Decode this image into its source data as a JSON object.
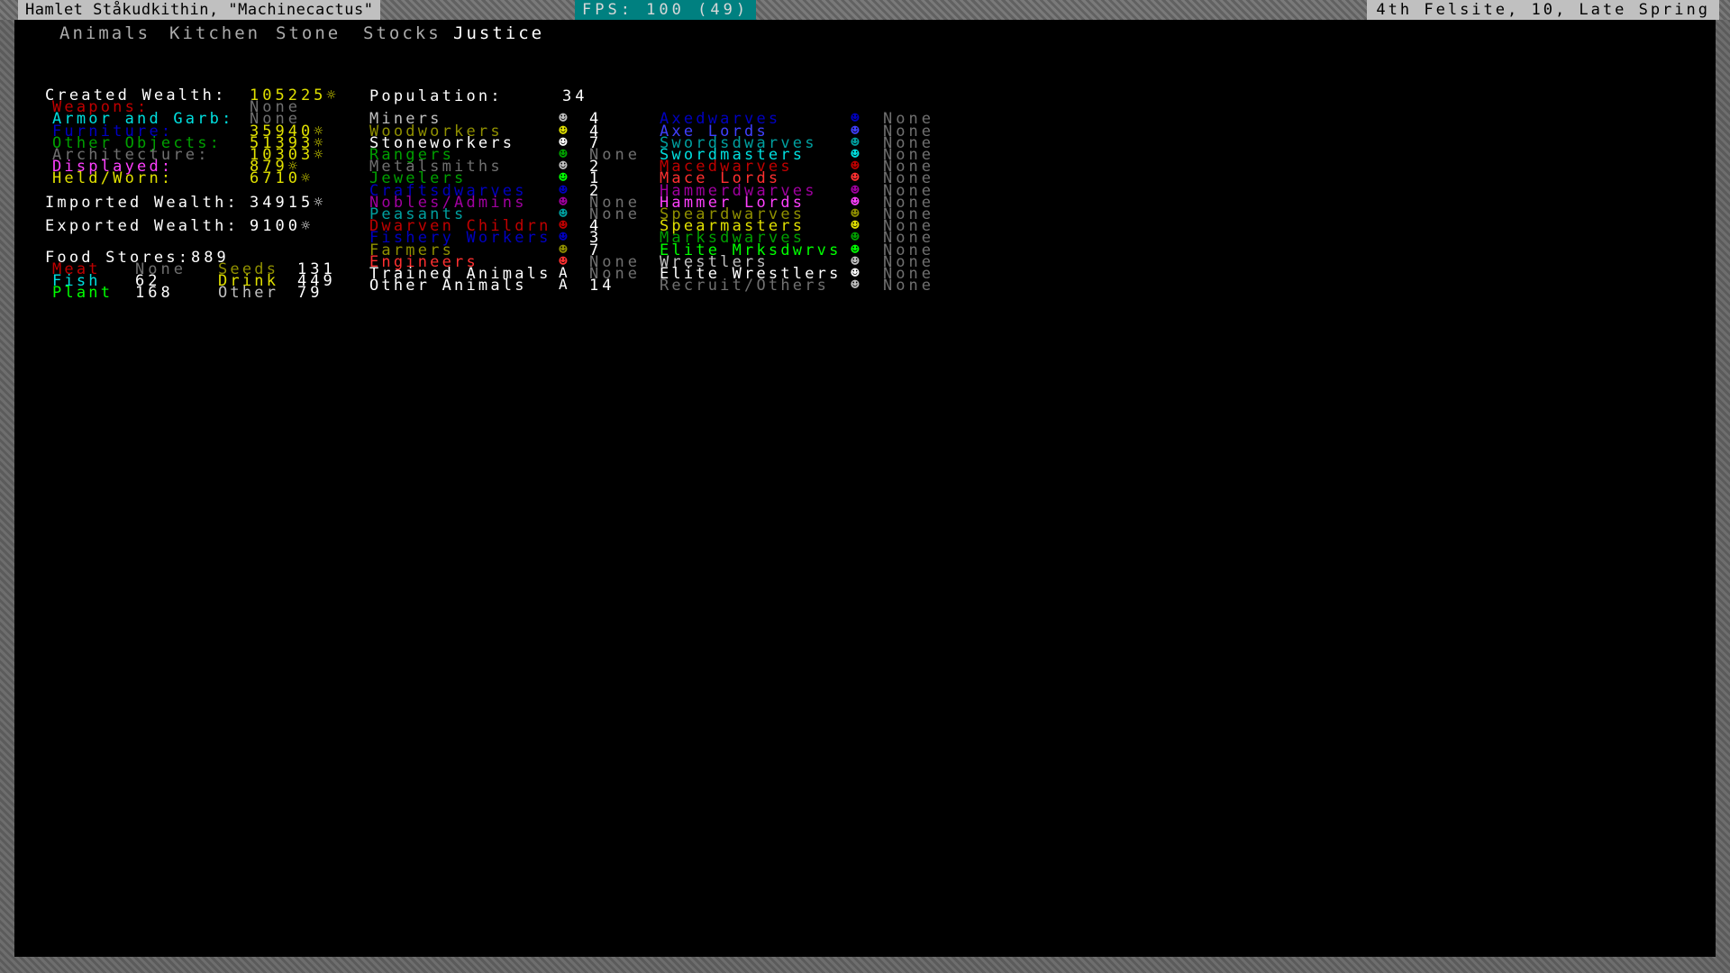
{
  "window": {
    "fort_title": "Hamlet Ståkudkithin, \"Machinecactus\"",
    "fps": "FPS: 100 (49)",
    "date": "4th Felsite, 10, Late Spring"
  },
  "menubar": {
    "items": [
      {
        "label": "Animals",
        "selected": false
      },
      {
        "label": "Kitchen",
        "selected": false
      },
      {
        "label": "Stone",
        "selected": false
      },
      {
        "label": "Stocks",
        "selected": false
      },
      {
        "label": "Justice",
        "selected": true
      }
    ]
  },
  "wealth": {
    "created_label": "Created Wealth:",
    "created_value": "105225☼",
    "breakdown": [
      {
        "label": "Weapons:",
        "value": "None",
        "label_color": "c-red",
        "value_color": "c-dgray"
      },
      {
        "label": "Armor and Garb:",
        "value": "None",
        "label_color": "c-lcyan",
        "value_color": "c-dgray"
      },
      {
        "label": "Furniture:",
        "value": "35940☼",
        "label_color": "c-blue",
        "value_color": "c-yellow"
      },
      {
        "label": "Other Objects:",
        "value": "51393☼",
        "label_color": "c-green",
        "value_color": "c-yellow"
      },
      {
        "label": "Architecture:",
        "value": "10303☼",
        "label_color": "c-dgray",
        "value_color": "c-yellow"
      },
      {
        "label": "Displayed:",
        "value": "879☼",
        "label_color": "c-lmag",
        "value_color": "c-yellow"
      },
      {
        "label": "Held/Worn:",
        "value": "6710☼",
        "label_color": "c-yellow",
        "value_color": "c-yellow"
      }
    ],
    "imported_label": "Imported Wealth:",
    "imported_value": "34915☼",
    "exported_label": "Exported Wealth:",
    "exported_value": "9100☼"
  },
  "food": {
    "title_label": "Food Stores:",
    "title_value": "889",
    "items": [
      {
        "label": "Meat",
        "value": "None",
        "label_color": "c-red",
        "value_color": "c-dgray",
        "col": 0,
        "line": 0
      },
      {
        "label": "Seeds",
        "value": "131",
        "label_color": "c-brown",
        "value_color": "c-white",
        "col": 1,
        "line": 0
      },
      {
        "label": "Fish",
        "value": "62",
        "label_color": "c-lcyan",
        "value_color": "c-white",
        "col": 0,
        "line": 1
      },
      {
        "label": "Drink",
        "value": "449",
        "label_color": "c-yellow",
        "value_color": "c-white",
        "col": 1,
        "line": 1
      },
      {
        "label": "Plant",
        "value": "168",
        "label_color": "c-lgreen",
        "value_color": "c-white",
        "col": 0,
        "line": 2
      },
      {
        "label": "Other",
        "value": "79",
        "label_color": "c-lgray",
        "value_color": "c-white",
        "col": 1,
        "line": 2
      }
    ]
  },
  "population": {
    "label": "Population:",
    "value": "34",
    "civilian": [
      {
        "label": "Miners",
        "count": "4",
        "label_color": "c-lgray",
        "glyph_color": "c-lgray",
        "count_color": "c-white"
      },
      {
        "label": "Woodworkers",
        "count": "4",
        "label_color": "c-brown",
        "glyph_color": "c-yellow",
        "count_color": "c-white"
      },
      {
        "label": "Stoneworkers",
        "count": "7",
        "label_color": "c-white",
        "glyph_color": "c-white",
        "count_color": "c-white"
      },
      {
        "label": "Rangers",
        "count": "None",
        "label_color": "c-green",
        "glyph_color": "c-green",
        "count_color": "c-dgray"
      },
      {
        "label": "Metalsmiths",
        "count": "2",
        "label_color": "c-dgray",
        "glyph_color": "c-lgray",
        "count_color": "c-white"
      },
      {
        "label": "Jewelers",
        "count": "1",
        "label_color": "c-green",
        "glyph_color": "c-lgreen",
        "count_color": "c-white"
      },
      {
        "label": "Craftsdwarves",
        "count": "2",
        "label_color": "c-blue",
        "glyph_color": "c-blue",
        "count_color": "c-white"
      },
      {
        "label": "Nobles/Admins",
        "count": "None",
        "label_color": "c-magenta",
        "glyph_color": "c-magenta",
        "count_color": "c-dgray"
      },
      {
        "label": "Peasants",
        "count": "None",
        "label_color": "c-cyan",
        "glyph_color": "c-cyan",
        "count_color": "c-dgray"
      },
      {
        "label": "Dwarven Childrn",
        "count": "4",
        "label_color": "c-red",
        "glyph_color": "c-red",
        "count_color": "c-white"
      },
      {
        "label": "Fishery Workers",
        "count": "3",
        "label_color": "c-blue",
        "glyph_color": "c-blue",
        "count_color": "c-white"
      },
      {
        "label": "Farmers",
        "count": "7",
        "label_color": "c-brown",
        "glyph_color": "c-brown",
        "count_color": "c-white"
      },
      {
        "label": "Engineers",
        "count": "None",
        "label_color": "c-lred",
        "glyph_color": "c-lred",
        "count_color": "c-dgray"
      },
      {
        "label": "Trained Animals",
        "count": "None",
        "label_color": "c-white",
        "glyph_color": "c-white",
        "count_color": "c-dgray",
        "glyph": "A"
      },
      {
        "label": "Other Animals",
        "count": "14",
        "label_color": "c-white",
        "glyph_color": "c-white",
        "count_color": "c-white",
        "glyph": "A"
      }
    ],
    "military": [
      {
        "label": "Axedwarves",
        "count": "None",
        "label_color": "c-blue",
        "glyph_color": "c-blue",
        "count_color": "c-dgray"
      },
      {
        "label": "Axe Lords",
        "count": "None",
        "label_color": "c-lblue",
        "glyph_color": "c-lblue",
        "count_color": "c-dgray"
      },
      {
        "label": "Swordsdwarves",
        "count": "None",
        "label_color": "c-cyan",
        "glyph_color": "c-cyan",
        "count_color": "c-dgray"
      },
      {
        "label": "Swordmasters",
        "count": "None",
        "label_color": "c-lcyan",
        "glyph_color": "c-lcyan",
        "count_color": "c-dgray"
      },
      {
        "label": "Macedwarves",
        "count": "None",
        "label_color": "c-red",
        "glyph_color": "c-red",
        "count_color": "c-dgray"
      },
      {
        "label": "Mace Lords",
        "count": "None",
        "label_color": "c-lred",
        "glyph_color": "c-lred",
        "count_color": "c-dgray"
      },
      {
        "label": "Hammerdwarves",
        "count": "None",
        "label_color": "c-magenta",
        "glyph_color": "c-magenta",
        "count_color": "c-dgray"
      },
      {
        "label": "Hammer Lords",
        "count": "None",
        "label_color": "c-lmag",
        "glyph_color": "c-lmag",
        "count_color": "c-dgray"
      },
      {
        "label": "Speardwarves",
        "count": "None",
        "label_color": "c-brown",
        "glyph_color": "c-brown",
        "count_color": "c-dgray"
      },
      {
        "label": "Spearmasters",
        "count": "None",
        "label_color": "c-yellow",
        "glyph_color": "c-yellow",
        "count_color": "c-dgray"
      },
      {
        "label": "Marksdwarves",
        "count": "None",
        "label_color": "c-green",
        "glyph_color": "c-green",
        "count_color": "c-dgray"
      },
      {
        "label": "Elite Mrksdwrvs",
        "count": "None",
        "label_color": "c-lgreen",
        "glyph_color": "c-lgreen",
        "count_color": "c-dgray"
      },
      {
        "label": "Wrestlers",
        "count": "None",
        "label_color": "c-lgray",
        "glyph_color": "c-lgray",
        "count_color": "c-dgray"
      },
      {
        "label": "Elite Wrestlers",
        "count": "None",
        "label_color": "c-white",
        "glyph_color": "c-white",
        "count_color": "c-dgray"
      },
      {
        "label": "Recruit/Others",
        "count": "None",
        "label_color": "c-dgray",
        "glyph_color": "c-lgray",
        "count_color": "c-dgray"
      }
    ]
  }
}
